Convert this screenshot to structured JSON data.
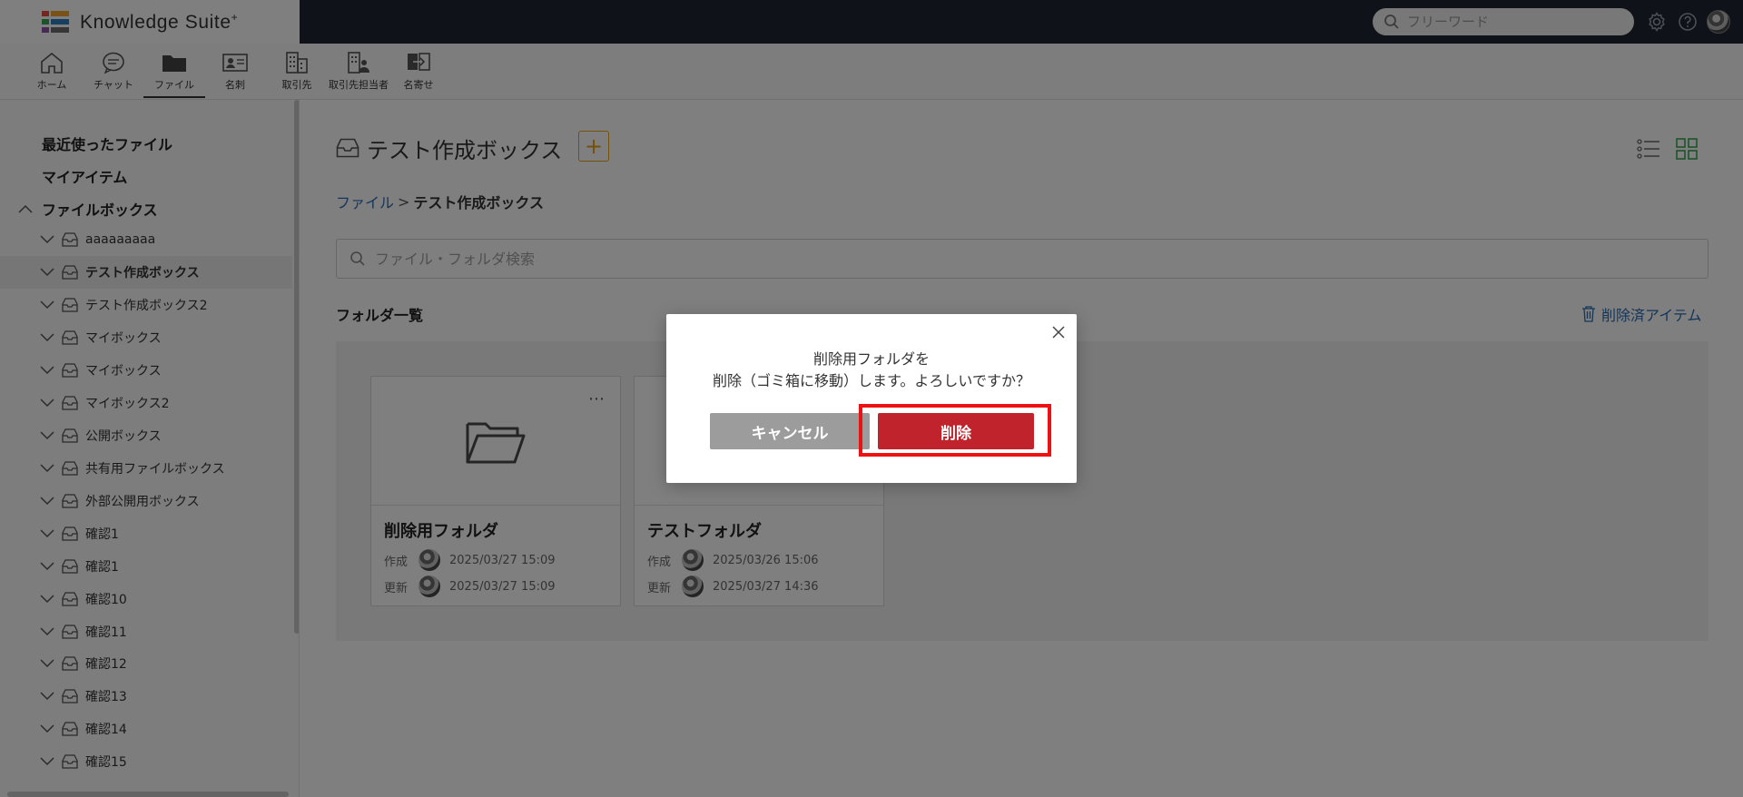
{
  "app": {
    "brand_name": "Knowledge Suite",
    "brand_mark": "+"
  },
  "top_search": {
    "placeholder": "フリーワード"
  },
  "nav": [
    {
      "label": "ホーム",
      "icon": "home-icon"
    },
    {
      "label": "チャット",
      "icon": "chat-icon"
    },
    {
      "label": "ファイル",
      "icon": "folder-icon",
      "active": true
    },
    {
      "label": "名刺",
      "icon": "business-card-icon"
    },
    {
      "label": "取引先",
      "icon": "building-icon"
    },
    {
      "label": "取引先担当者",
      "icon": "building-person-icon"
    },
    {
      "label": "名寄せ",
      "icon": "merge-icon"
    }
  ],
  "sidebar": {
    "recent": "最近使ったファイル",
    "my_items": "マイアイテム",
    "filebox": "ファイルボックス",
    "items": [
      {
        "label": "aaaaaaaaa"
      },
      {
        "label": "テスト作成ボックス",
        "active": true
      },
      {
        "label": "テスト作成ボックス2"
      },
      {
        "label": "マイボックス"
      },
      {
        "label": "マイボックス"
      },
      {
        "label": "マイボックス2"
      },
      {
        "label": "公開ボックス"
      },
      {
        "label": "共有用ファイルボックス"
      },
      {
        "label": "外部公開用ボックス"
      },
      {
        "label": "確認1"
      },
      {
        "label": "確認1"
      },
      {
        "label": "確認10"
      },
      {
        "label": "確認11"
      },
      {
        "label": "確認12"
      },
      {
        "label": "確認13"
      },
      {
        "label": "確認14"
      },
      {
        "label": "確認15"
      }
    ]
  },
  "main": {
    "box_title": "テスト作成ボックス",
    "add_label": "+",
    "breadcrumb": {
      "root": "ファイル",
      "sep": ">",
      "current": "テスト作成ボックス"
    },
    "search_placeholder": "ファイル・フォルダ検索",
    "section_title": "フォルダ一覧",
    "trash_label": "削除済アイテム",
    "folders": [
      {
        "name": "削除用フォルダ",
        "created_label": "作成",
        "created": "2025/03/27 15:09",
        "updated_label": "更新",
        "updated": "2025/03/27 15:09",
        "menu": "⋯"
      },
      {
        "name": "テストフォルダ",
        "created_label": "作成",
        "created": "2025/03/26 15:06",
        "updated_label": "更新",
        "updated": "2025/03/27 14:36"
      }
    ]
  },
  "dialog": {
    "line1": "削除用フォルダを",
    "line2": "削除（ゴミ箱に移動）します。よろしいですか？",
    "cancel_label": "キャンセル",
    "delete_label": "削除"
  },
  "colors": {
    "topbar": "#1f2430",
    "accent_orange": "#e8a317",
    "link_blue": "#2b6cb0",
    "delete_red": "#c0232c",
    "highlight_red": "#ee1111"
  }
}
